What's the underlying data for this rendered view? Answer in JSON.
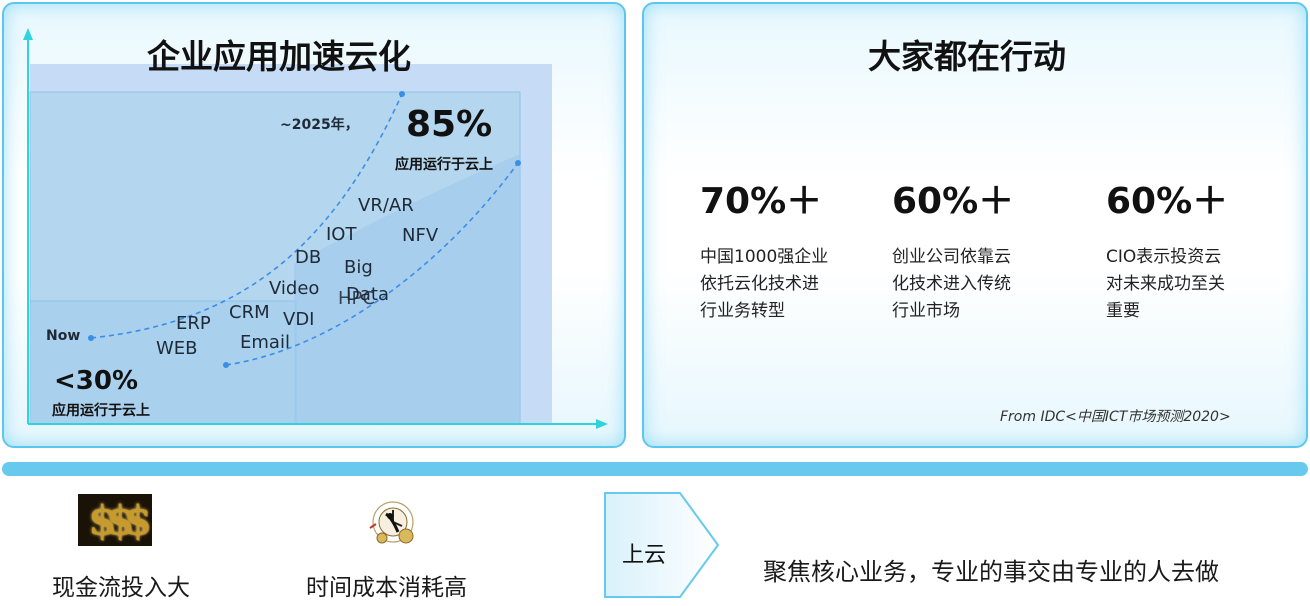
{
  "left_panel": {
    "title": "企业应用加速云化"
  },
  "chart_data": {
    "type": "line",
    "xlabel": "",
    "ylabel": "",
    "series": [
      {
        "name": "",
        "from_label": "Now",
        "to_label": "~2025年，"
      },
      {
        "name": "",
        "from_label": "",
        "to_label": ""
      }
    ],
    "start": {
      "value": "<30%",
      "caption": "应用运行于云上"
    },
    "end": {
      "value": "85%",
      "caption": "应用运行于云上"
    },
    "markers": {
      "now": "Now",
      "year": "~2025年，"
    },
    "app_labels": [
      "WEB",
      "ERP",
      "CRM",
      "Email",
      "Video",
      "VDI",
      "DB",
      "IOT",
      "Big",
      "Data",
      "HPC",
      "VR/AR",
      "NFV"
    ],
    "grid": false,
    "accent_color": "#3b8ee6",
    "axis_color": "#2fd3de"
  },
  "right_panel": {
    "title": "大家都在行动",
    "stats": [
      {
        "value": "70%＋",
        "desc": "中国1000强企业\n依托云化技术进\n行业务转型"
      },
      {
        "value": "60%＋",
        "desc": "创业公司依靠云\n化技术进入传统\n行业市场"
      },
      {
        "value": "60%＋",
        "desc": "CIO表示投资云\n对未来成功至关\n重要"
      }
    ],
    "source": "From IDC<中国ICT市场预测2020>"
  },
  "bottom": {
    "items": [
      {
        "icon": "money-icon",
        "icon_text": "$$$",
        "caption": "现金流投入大"
      },
      {
        "icon": "clock-icon",
        "caption": "时间成本消耗高"
      }
    ],
    "arrow_label": "上云",
    "focus_text": "聚焦核心业务，专业的事交由专业的人去做"
  },
  "colors": {
    "panel_border": "#5cc7ee",
    "divider": "#67c9ee"
  }
}
